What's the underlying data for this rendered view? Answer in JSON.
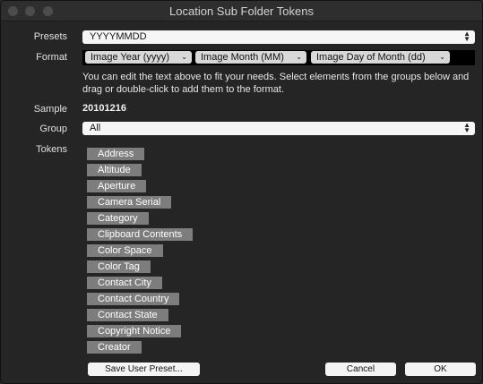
{
  "window": {
    "title": "Location Sub Folder Tokens"
  },
  "labels": {
    "presets": "Presets",
    "format": "Format",
    "sample": "Sample",
    "group": "Group",
    "tokens": "Tokens"
  },
  "presets": {
    "value": "YYYYMMDD"
  },
  "format_tokens": [
    "Image Year (yyyy)",
    "Image Month (MM)",
    "Image Day of Month (dd)"
  ],
  "help_text": "You can edit the text above to fit your needs. Select elements from the groups below and drag or double-click to add them to the format.",
  "sample": {
    "value": "20101216"
  },
  "group": {
    "value": "All"
  },
  "tokens": [
    "Address",
    "Altitude",
    "Aperture",
    "Camera Serial",
    "Category",
    "Clipboard Contents",
    "Color Space",
    "Color Tag",
    "Contact City",
    "Contact Country",
    "Contact State",
    "Copyright Notice",
    "Creator"
  ],
  "buttons": {
    "save_preset": "Save User Preset...",
    "cancel": "Cancel",
    "ok": "OK"
  }
}
